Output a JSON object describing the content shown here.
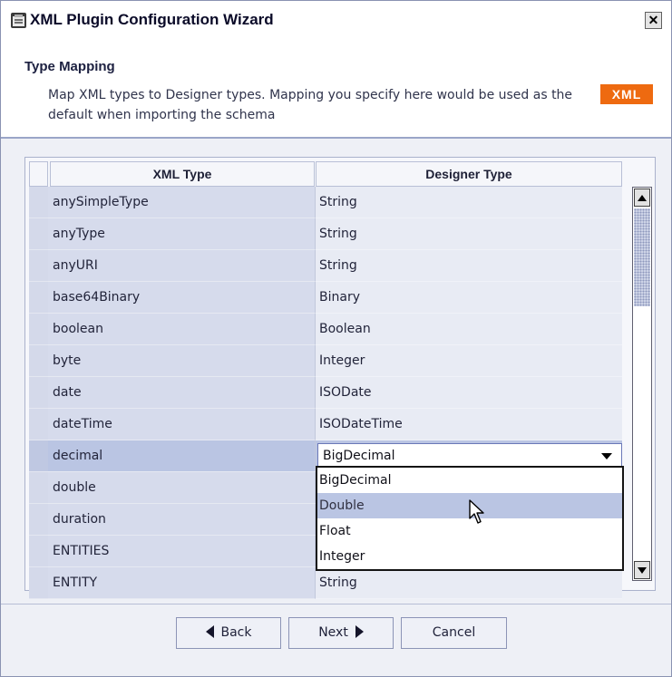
{
  "window": {
    "title": "XML Plugin Configuration Wizard",
    "close_label": "✕"
  },
  "header": {
    "title": "Type Mapping",
    "description": "Map XML types to Designer types. Mapping you specify here would be used as the default when importing the schema",
    "badge": "XML",
    "badge_color": "#ee6a10"
  },
  "table": {
    "columns": [
      "XML Type",
      "Designer Type"
    ],
    "rows": [
      {
        "xml": "anySimpleType",
        "designer": "String"
      },
      {
        "xml": "anyType",
        "designer": "String"
      },
      {
        "xml": "anyURI",
        "designer": "String"
      },
      {
        "xml": "base64Binary",
        "designer": "Binary"
      },
      {
        "xml": "boolean",
        "designer": "Boolean"
      },
      {
        "xml": "byte",
        "designer": "Integer"
      },
      {
        "xml": "date",
        "designer": "ISODate"
      },
      {
        "xml": "dateTime",
        "designer": "ISODateTime"
      },
      {
        "xml": "decimal",
        "designer": "BigDecimal"
      },
      {
        "xml": "double",
        "designer": ""
      },
      {
        "xml": "duration",
        "designer": ""
      },
      {
        "xml": "ENTITIES",
        "designer": ""
      },
      {
        "xml": "ENTITY",
        "designer": "String"
      }
    ],
    "selected_row_index": 8,
    "selected_row_color": "#bac5e3"
  },
  "dropdown": {
    "selected_value": "BigDecimal",
    "options": [
      "BigDecimal",
      "Double",
      "Float",
      "Integer"
    ],
    "hovered_option": "Double"
  },
  "buttons": {
    "back": "Back",
    "next": "Next",
    "cancel": "Cancel"
  }
}
